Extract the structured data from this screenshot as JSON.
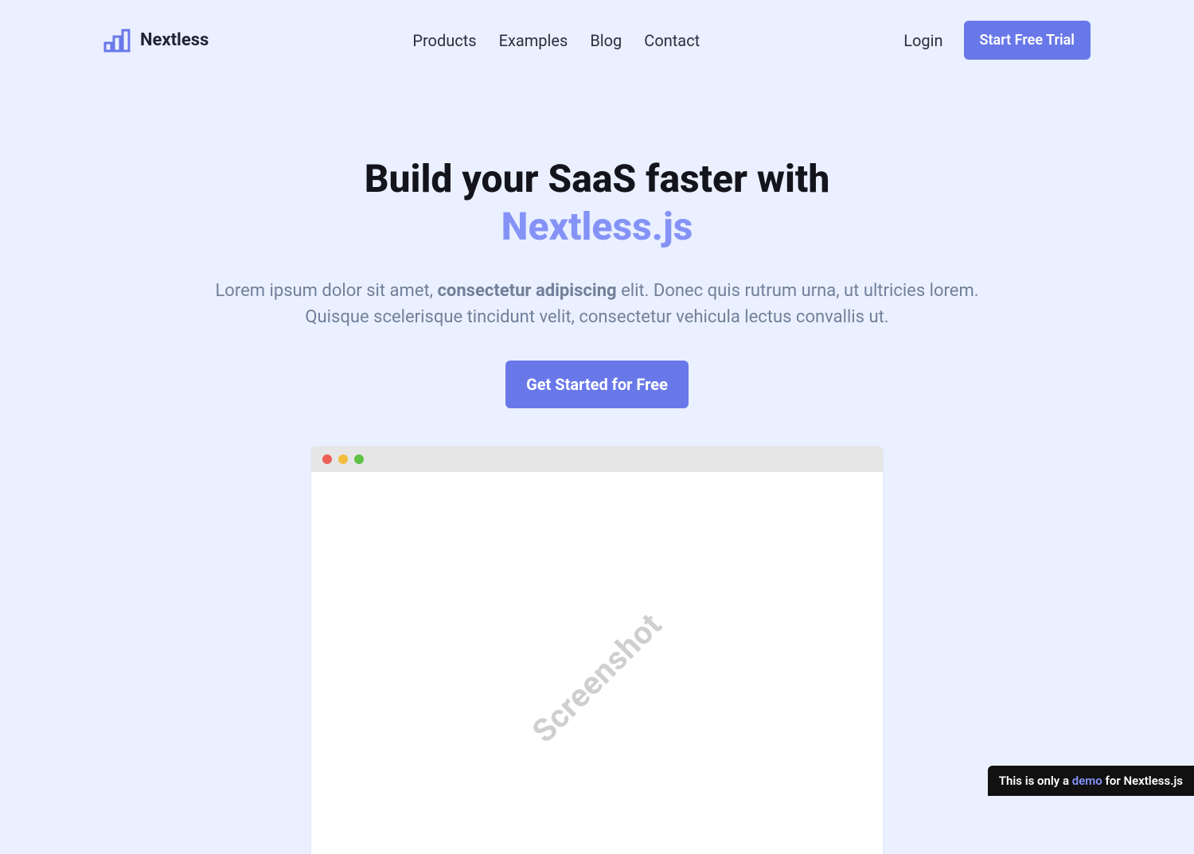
{
  "brand": {
    "name": "Nextless"
  },
  "nav": {
    "items": [
      "Products",
      "Examples",
      "Blog",
      "Contact"
    ]
  },
  "auth": {
    "login": "Login",
    "trial_cta": "Start Free Trial"
  },
  "hero": {
    "title_plain": "Build your SaaS faster with",
    "title_accent": "Nextless.js",
    "sub_before": "Lorem ipsum dolor sit amet, ",
    "sub_bold": "consectetur adipiscing",
    "sub_after": " elit. Donec quis rutrum urna, ut ultricies lorem. Quisque scelerisque tincidunt velit, consectetur vehicula lectus convallis ut.",
    "cta": "Get Started for Free"
  },
  "mock": {
    "watermark": "Screenshot"
  },
  "ribbon": {
    "before": "This is only a ",
    "word": "demo",
    "after": " for Nextless.js"
  },
  "colors": {
    "bg": "#eaf0ff",
    "accent": "#6978e9",
    "accent2": "#8593f7"
  }
}
